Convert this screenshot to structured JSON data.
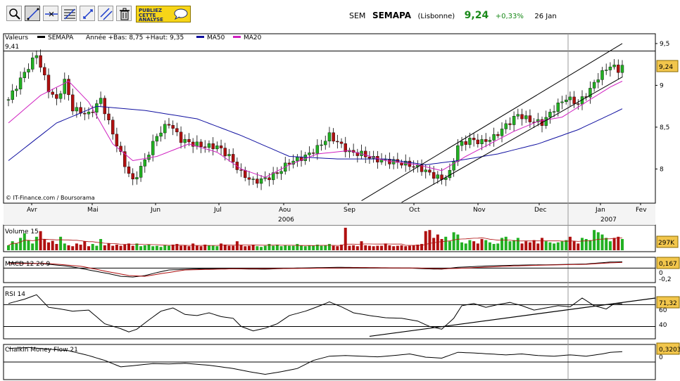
{
  "toolbar": {
    "tools": [
      {
        "icon": "zoom-icon"
      },
      {
        "icon": "draw-line-icon"
      },
      {
        "icon": "horizontal-line-icon"
      },
      {
        "icon": "fibonacci-icon"
      },
      {
        "icon": "vertical-line-icon"
      },
      {
        "icon": "parallel-lines-icon"
      },
      {
        "icon": "trash-icon"
      }
    ],
    "promo_line1": "PUBLIEZ",
    "promo_line2": "CETTE",
    "promo_line3": "ANALYSE"
  },
  "quote": {
    "market": "SEM",
    "name": "SEMAPA",
    "exchange": "(Lisbonne)",
    "price": "9,24",
    "change": "+0,33%",
    "date": "26 Jan"
  },
  "colors": {
    "up": "#22b022",
    "down": "#b01010",
    "ma50": "#1010a0",
    "ma20": "#d020c0",
    "flag": "#f2c64c"
  },
  "chart_data": [
    {
      "type": "candlestick",
      "title": "Valeurs",
      "series_label": "SEMAPA",
      "range_text": "Année +Bas: 8,75 +Haut: 9,35",
      "legend": [
        {
          "name": "SEMAPA",
          "color": "#000000"
        },
        {
          "name": "MA50",
          "color": "#1010a0"
        },
        {
          "name": "MA20",
          "color": "#d020c0"
        }
      ],
      "high_label": "9,41",
      "last_value_label": "9,24",
      "credit": "© IT-Finance.com / Boursorama",
      "y_ticks": [
        "9,5",
        "9",
        "8,5",
        "8"
      ],
      "ylim": [
        7.65,
        9.55
      ],
      "x_months": [
        "Avr",
        "Mai",
        "Jun",
        "Jul",
        "Aou",
        "Sep",
        "Oct",
        "Nov",
        "Dec",
        "Jan",
        "Fev"
      ],
      "year_labels": [
        "2006",
        "2007"
      ],
      "close_path": [
        [
          0,
          8.83
        ],
        [
          4,
          9.15
        ],
        [
          7,
          9.37
        ],
        [
          10,
          8.95
        ],
        [
          12,
          8.82
        ],
        [
          14,
          9.05
        ],
        [
          16,
          8.72
        ],
        [
          20,
          8.65
        ],
        [
          23,
          8.83
        ],
        [
          26,
          8.42
        ],
        [
          29,
          8.05
        ],
        [
          31,
          7.85
        ],
        [
          34,
          8.1
        ],
        [
          37,
          8.4
        ],
        [
          40,
          8.55
        ],
        [
          43,
          8.35
        ],
        [
          46,
          8.3
        ],
        [
          49,
          8.27
        ],
        [
          52,
          8.27
        ],
        [
          55,
          8.15
        ],
        [
          58,
          7.95
        ],
        [
          61,
          7.85
        ],
        [
          64,
          7.88
        ],
        [
          67,
          7.95
        ],
        [
          70,
          8.08
        ],
        [
          74,
          8.15
        ],
        [
          77,
          8.25
        ],
        [
          80,
          8.4
        ],
        [
          82,
          8.32
        ],
        [
          85,
          8.2
        ],
        [
          88,
          8.18
        ],
        [
          91,
          8.12
        ],
        [
          94,
          8.1
        ],
        [
          97,
          8.08
        ],
        [
          100,
          8.05
        ],
        [
          103,
          8.0
        ],
        [
          106,
          7.92
        ],
        [
          108,
          7.88
        ],
        [
          110,
          7.95
        ],
        [
          112,
          8.28
        ],
        [
          115,
          8.35
        ],
        [
          118,
          8.32
        ],
        [
          121,
          8.38
        ],
        [
          124,
          8.52
        ],
        [
          127,
          8.65
        ],
        [
          130,
          8.58
        ],
        [
          133,
          8.55
        ],
        [
          136,
          8.72
        ],
        [
          139,
          8.85
        ],
        [
          142,
          8.78
        ],
        [
          145,
          8.95
        ],
        [
          147,
          9.1
        ],
        [
          150,
          9.24
        ],
        [
          152,
          9.18
        ],
        [
          153,
          9.24
        ]
      ],
      "ma50_path": [
        [
          0,
          8.1
        ],
        [
          12,
          8.55
        ],
        [
          22,
          8.75
        ],
        [
          34,
          8.7
        ],
        [
          47,
          8.6
        ],
        [
          58,
          8.4
        ],
        [
          70,
          8.15
        ],
        [
          82,
          8.12
        ],
        [
          94,
          8.12
        ],
        [
          104,
          8.05
        ],
        [
          112,
          8.1
        ],
        [
          122,
          8.18
        ],
        [
          132,
          8.3
        ],
        [
          142,
          8.47
        ],
        [
          150,
          8.65
        ],
        [
          153,
          8.72
        ]
      ],
      "ma20_path": [
        [
          0,
          8.55
        ],
        [
          8,
          8.88
        ],
        [
          15,
          9.05
        ],
        [
          20,
          8.8
        ],
        [
          26,
          8.3
        ],
        [
          31,
          8.1
        ],
        [
          37,
          8.15
        ],
        [
          45,
          8.3
        ],
        [
          52,
          8.2
        ],
        [
          58,
          8.0
        ],
        [
          64,
          7.9
        ],
        [
          70,
          8.05
        ],
        [
          77,
          8.18
        ],
        [
          85,
          8.22
        ],
        [
          94,
          8.1
        ],
        [
          102,
          8.05
        ],
        [
          108,
          7.98
        ],
        [
          114,
          8.15
        ],
        [
          120,
          8.3
        ],
        [
          126,
          8.45
        ],
        [
          132,
          8.57
        ],
        [
          138,
          8.62
        ],
        [
          144,
          8.8
        ],
        [
          150,
          8.98
        ],
        [
          153,
          9.05
        ]
      ],
      "channel_upper": [
        [
          88,
          7.62
        ],
        [
          153,
          9.5
        ]
      ],
      "channel_lower": [
        [
          98,
          7.6
        ],
        [
          153,
          9.1
        ]
      ]
    },
    {
      "type": "bar",
      "title": "Volume 15",
      "last_value_label": "297K",
      "volumes": [
        0.22,
        0.4,
        0.3,
        0.55,
        0.75,
        0.45,
        0.3,
        0.6,
        0.85,
        0.5,
        0.35,
        0.42,
        0.28,
        0.6,
        0.3,
        0.22,
        0.18,
        0.3,
        0.25,
        0.4,
        0.18,
        0.28,
        0.2,
        0.5,
        0.22,
        0.3,
        0.2,
        0.25,
        0.2,
        0.25,
        0.3,
        0.2,
        0.3,
        0.18,
        0.22,
        0.25,
        0.18,
        0.2,
        0.15,
        0.22,
        0.2,
        0.25,
        0.28,
        0.2,
        0.22,
        0.18,
        0.3,
        0.2,
        0.18,
        0.25,
        0.22,
        0.2,
        0.18,
        0.3,
        0.25,
        0.2,
        0.2,
        0.4,
        0.22,
        0.18,
        0.2,
        0.25,
        0.18,
        0.15,
        0.2,
        0.28,
        0.2,
        0.25,
        0.18,
        0.22,
        0.2,
        0.2,
        0.28,
        0.22,
        0.18,
        0.22,
        0.2,
        0.25,
        0.2,
        0.22,
        0.28,
        0.2,
        0.18,
        0.25,
        1.0,
        0.2,
        0.22,
        0.18,
        0.4,
        0.22,
        0.2,
        0.18,
        0.2,
        0.2,
        0.3,
        0.22,
        0.18,
        0.2,
        0.22,
        0.18,
        0.2,
        0.22,
        0.25,
        0.28,
        0.85,
        0.9,
        0.55,
        0.7,
        0.5,
        0.6,
        0.4,
        0.8,
        0.7,
        0.35,
        0.3,
        0.45,
        0.4,
        0.3,
        0.5,
        0.45,
        0.35,
        0.28,
        0.3,
        0.55,
        0.6,
        0.4,
        0.45,
        0.55,
        0.3,
        0.4,
        0.35,
        0.45,
        0.3,
        0.55,
        0.4,
        0.35,
        0.3,
        0.35,
        0.4,
        0.45,
        0.6,
        0.4,
        0.3,
        0.55,
        0.5,
        0.45,
        0.9,
        0.8,
        0.7,
        0.55,
        0.4,
        0.55,
        0.6,
        0.5
      ]
    },
    {
      "type": "line",
      "title": "MACD 12 26 9",
      "last_value_label": "0,167",
      "y_ticks": [
        "0",
        "-0,2"
      ],
      "ylim": [
        -0.35,
        0.25
      ],
      "macd_path": [
        [
          0,
          0.15
        ],
        [
          8,
          0.12
        ],
        [
          15,
          0.05
        ],
        [
          20,
          -0.05
        ],
        [
          25,
          -0.15
        ],
        [
          28,
          -0.22
        ],
        [
          31,
          -0.24
        ],
        [
          34,
          -0.2
        ],
        [
          37,
          -0.12
        ],
        [
          40,
          -0.05
        ],
        [
          48,
          -0.02
        ],
        [
          56,
          -0.02
        ],
        [
          64,
          -0.03
        ],
        [
          72,
          0.0
        ],
        [
          82,
          0.02
        ],
        [
          92,
          0.01
        ],
        [
          100,
          0.0
        ],
        [
          104,
          -0.02
        ],
        [
          108,
          -0.03
        ],
        [
          112,
          0.02
        ],
        [
          120,
          0.06
        ],
        [
          128,
          0.08
        ],
        [
          136,
          0.09
        ],
        [
          144,
          0.11
        ],
        [
          150,
          0.16
        ],
        [
          153,
          0.167
        ]
      ],
      "signal_path": [
        [
          0,
          0.12
        ],
        [
          10,
          0.12
        ],
        [
          18,
          0.05
        ],
        [
          24,
          -0.08
        ],
        [
          30,
          -0.2
        ],
        [
          34,
          -0.22
        ],
        [
          38,
          -0.15
        ],
        [
          44,
          -0.05
        ],
        [
          56,
          -0.02
        ],
        [
          72,
          -0.01
        ],
        [
          88,
          0.01
        ],
        [
          102,
          0.0
        ],
        [
          108,
          -0.02
        ],
        [
          114,
          0.0
        ],
        [
          124,
          0.05
        ],
        [
          134,
          0.08
        ],
        [
          144,
          0.1
        ],
        [
          150,
          0.14
        ],
        [
          153,
          0.15
        ]
      ]
    },
    {
      "type": "line",
      "title": "RSI 14",
      "last_value_label": "71,32",
      "y_ticks": [
        "60",
        "40"
      ],
      "ylim": [
        10,
        100
      ],
      "rsi_path": [
        [
          0,
          72
        ],
        [
          4,
          80
        ],
        [
          7,
          88
        ],
        [
          10,
          65
        ],
        [
          13,
          62
        ],
        [
          16,
          58
        ],
        [
          20,
          60
        ],
        [
          24,
          35
        ],
        [
          28,
          26
        ],
        [
          30,
          20
        ],
        [
          32,
          25
        ],
        [
          35,
          42
        ],
        [
          38,
          58
        ],
        [
          41,
          64
        ],
        [
          44,
          52
        ],
        [
          47,
          50
        ],
        [
          50,
          55
        ],
        [
          53,
          48
        ],
        [
          56,
          45
        ],
        [
          58,
          30
        ],
        [
          61,
          22
        ],
        [
          64,
          27
        ],
        [
          67,
          35
        ],
        [
          70,
          50
        ],
        [
          74,
          58
        ],
        [
          77,
          66
        ],
        [
          80,
          75
        ],
        [
          83,
          66
        ],
        [
          86,
          55
        ],
        [
          90,
          50
        ],
        [
          94,
          46
        ],
        [
          98,
          45
        ],
        [
          102,
          40
        ],
        [
          105,
          30
        ],
        [
          108,
          25
        ],
        [
          111,
          45
        ],
        [
          113,
          68
        ],
        [
          116,
          72
        ],
        [
          119,
          65
        ],
        [
          122,
          70
        ],
        [
          125,
          74
        ],
        [
          128,
          68
        ],
        [
          131,
          60
        ],
        [
          134,
          64
        ],
        [
          137,
          68
        ],
        [
          140,
          66
        ],
        [
          143,
          82
        ],
        [
          146,
          68
        ],
        [
          149,
          62
        ],
        [
          151,
          72
        ],
        [
          153,
          71.32
        ]
      ],
      "trend_line": [
        [
          90,
          12
        ],
        [
          153,
          82
        ]
      ]
    },
    {
      "type": "line",
      "title": "Chalkin Money Flow 21",
      "last_value_label": "0,3203",
      "y_ticks": [
        "0"
      ],
      "ylim": [
        -0.5,
        0.5
      ],
      "cmf_path": [
        [
          0,
          0.42
        ],
        [
          5,
          0.45
        ],
        [
          10,
          0.4
        ],
        [
          15,
          0.35
        ],
        [
          20,
          0.2
        ],
        [
          24,
          0.05
        ],
        [
          28,
          -0.15
        ],
        [
          32,
          -0.1
        ],
        [
          36,
          -0.05
        ],
        [
          40,
          -0.06
        ],
        [
          44,
          -0.04
        ],
        [
          50,
          -0.1
        ],
        [
          56,
          -0.2
        ],
        [
          60,
          -0.3
        ],
        [
          64,
          -0.38
        ],
        [
          68,
          -0.3
        ],
        [
          72,
          -0.2
        ],
        [
          76,
          0.05
        ],
        [
          80,
          0.18
        ],
        [
          84,
          0.2
        ],
        [
          88,
          0.18
        ],
        [
          92,
          0.16
        ],
        [
          96,
          0.2
        ],
        [
          100,
          0.25
        ],
        [
          104,
          0.15
        ],
        [
          108,
          0.12
        ],
        [
          112,
          0.3
        ],
        [
          116,
          0.28
        ],
        [
          120,
          0.25
        ],
        [
          124,
          0.22
        ],
        [
          128,
          0.25
        ],
        [
          132,
          0.2
        ],
        [
          136,
          0.18
        ],
        [
          140,
          0.22
        ],
        [
          144,
          0.18
        ],
        [
          148,
          0.25
        ],
        [
          150,
          0.3
        ],
        [
          153,
          0.32
        ]
      ]
    }
  ]
}
